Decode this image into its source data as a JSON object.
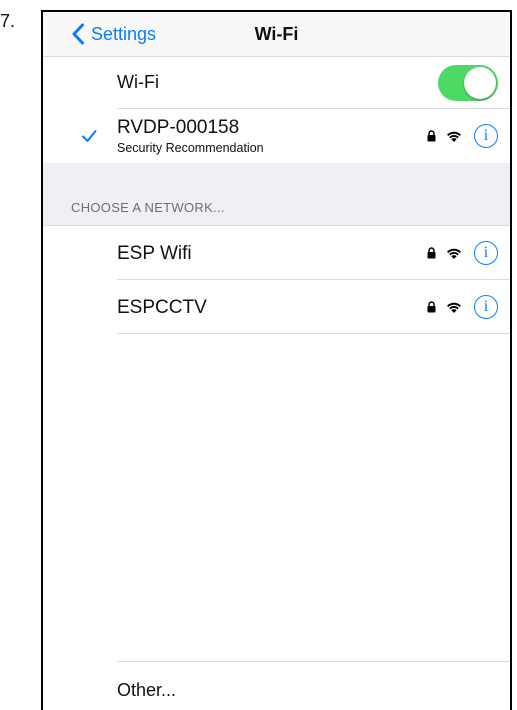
{
  "step_number": "7.",
  "navbar": {
    "back_label": "Settings",
    "title": "Wi-Fi"
  },
  "wifi_toggle": {
    "label": "Wi-Fi",
    "on": true,
    "color": "#4cd964"
  },
  "connected_network": {
    "name": "RVDP-000158",
    "subtitle": "Security Recommendation",
    "secured": true,
    "info_glyph": "i"
  },
  "section_header": "CHOOSE A NETWORK...",
  "networks": [
    {
      "name": "ESP Wifi",
      "secured": true,
      "info_glyph": "i"
    },
    {
      "name": "ESPCCTV",
      "secured": true,
      "info_glyph": "i"
    }
  ],
  "other_label": "Other...",
  "colors": {
    "accent": "#0a7cff",
    "group_background": "#efeff4"
  },
  "icons": [
    "chevron-left-icon",
    "checkmark-icon",
    "lock-icon",
    "wifi-icon",
    "info-icon"
  ]
}
